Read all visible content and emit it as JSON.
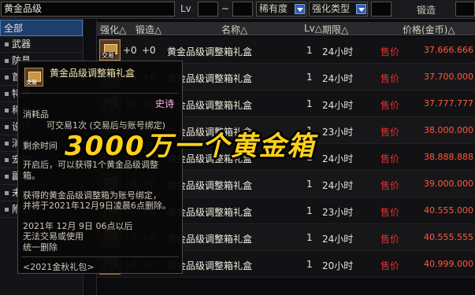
{
  "filter": {
    "search_value": "黄金品级",
    "lv_label": "Lv",
    "dash": "~",
    "rarity_select": "稀有度",
    "enhance_select": "强化类型",
    "forge_label": "锻造"
  },
  "categories": [
    {
      "label": "全部",
      "selected": true
    },
    {
      "label": "武器"
    },
    {
      "label": "防具"
    },
    {
      "label": "首饰"
    },
    {
      "label": "特殊"
    },
    {
      "label": "称号"
    },
    {
      "label": "设计"
    },
    {
      "label": "消耗"
    },
    {
      "label": "宠物"
    },
    {
      "label": "副职"
    },
    {
      "label": "未分"
    },
    {
      "label": "附加"
    }
  ],
  "table": {
    "headers": {
      "enhance": "强化△",
      "forge": "锻造△",
      "name": "名称△",
      "lv": "Lv△",
      "time": "期限△",
      "price": "价格(金币)△"
    },
    "rows": [
      {
        "enhance": "+0",
        "forge": "+0",
        "name": "黄金品级调整箱礼盒",
        "lv": "1",
        "time": "24小时",
        "seller": "售价",
        "price": "37.666.666",
        "tag": "交易"
      },
      {
        "enhance": "+0",
        "forge": "+0",
        "name": "黄金品级调整箱礼盒",
        "lv": "1",
        "time": "24小时",
        "seller": "售价",
        "price": "37.700.000",
        "tag": "交易"
      },
      {
        "enhance": "+0",
        "forge": "+0",
        "name": "黄金品级调整箱礼盒",
        "lv": "1",
        "time": "24小时",
        "seller": "售价",
        "price": "37.777.777",
        "tag": "交易"
      },
      {
        "enhance": "+0",
        "forge": "+0",
        "name": "黄金品级调整箱礼盒",
        "lv": "1",
        "time": "23小时",
        "seller": "售价",
        "price": "38.000.000",
        "tag": "交易"
      },
      {
        "enhance": "+0",
        "forge": "+0",
        "name": "黄金品级调整箱礼盒",
        "lv": "1",
        "time": "24小时",
        "seller": "售价",
        "price": "38.888.888",
        "tag": "交易"
      },
      {
        "enhance": "+0",
        "forge": "+0",
        "name": "黄金品级调整箱礼盒",
        "lv": "1",
        "time": "24小时",
        "seller": "售价",
        "price": "39.000.000",
        "tag": "交易"
      },
      {
        "enhance": "+0",
        "forge": "+0",
        "name": "黄金品级调整箱礼盒",
        "lv": "1",
        "time": "23小时",
        "seller": "售价",
        "price": "40.555.000",
        "tag": "交易"
      },
      {
        "enhance": "+0",
        "forge": "+0",
        "name": "黄金品级调整箱礼盒",
        "lv": "1",
        "time": "24小时",
        "seller": "售价",
        "price": "40.555.555",
        "tag": "交易"
      },
      {
        "enhance": "+0",
        "forge": "+0",
        "name": "黄金品级调整箱礼盒",
        "lv": "1",
        "time": "20小时",
        "seller": "售价",
        "price": "40.999.000",
        "tag": "交易"
      }
    ]
  },
  "tooltip": {
    "title": "黄金品级调整箱礼盒",
    "icon_tag": "交易",
    "rarity": "史诗",
    "type": "消耗品",
    "trade": "可交易1次 (交易后与账号绑定)",
    "remaining": "剩余时间",
    "desc1": "开启后，可以获得1个黄金品级调整",
    "desc2": "箱。",
    "desc3": "获得的黄金品级调整箱为账号绑定，",
    "desc4": "并将于2021年12月9日凌晨6点删除。",
    "exp1": "2021年 12月 9日 06点以后",
    "exp2": "无法交易或使用",
    "exp3": "统一删除",
    "footer": "<2021金秋礼包>"
  },
  "banner": "3000万一个黄金箱"
}
